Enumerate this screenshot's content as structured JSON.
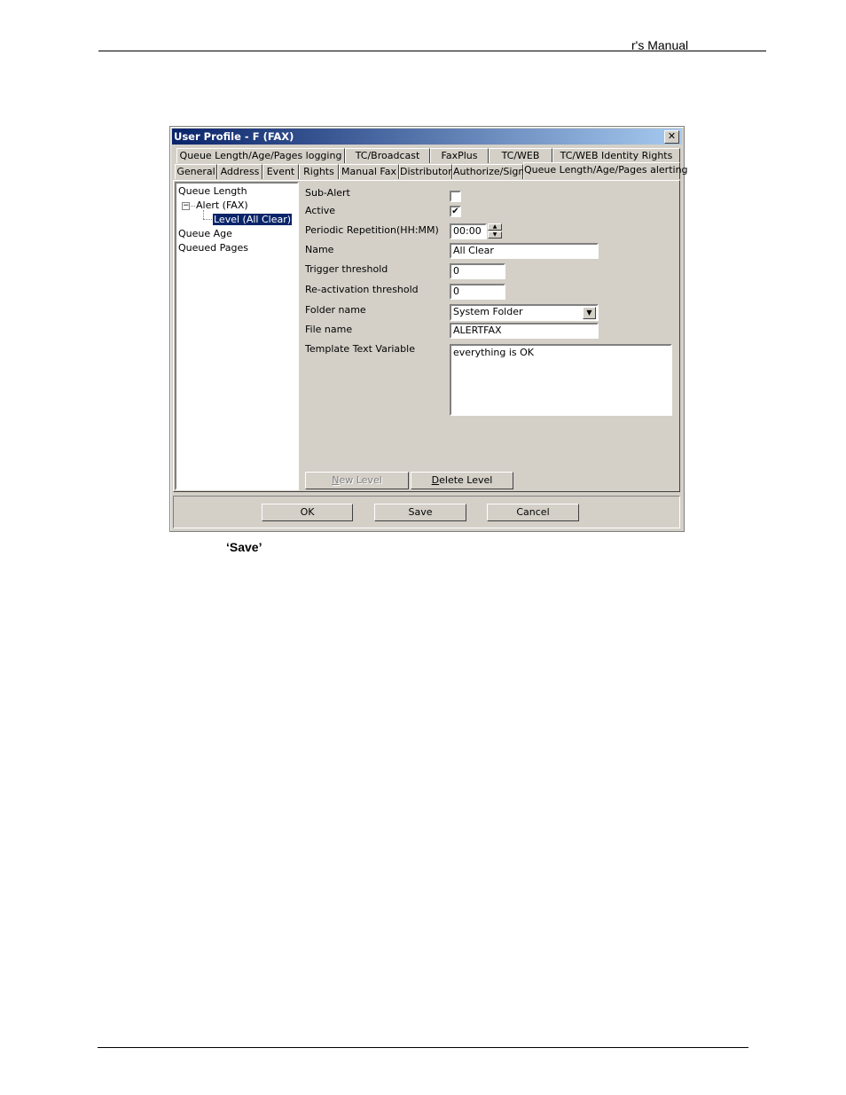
{
  "page": {
    "header_text": "r's Manual",
    "caption": "‘Save’"
  },
  "window": {
    "title": "User Profile - F (FAX)",
    "close_glyph": "✕"
  },
  "tabs_row1": [
    {
      "label": "Queue Length/Age/Pages logging"
    },
    {
      "label": "TC/Broadcast"
    },
    {
      "label": "FaxPlus"
    },
    {
      "label": "TC/WEB"
    },
    {
      "label": "TC/WEB Identity Rights"
    }
  ],
  "tabs_row2": [
    {
      "label": "General"
    },
    {
      "label": "Address"
    },
    {
      "label": "Event"
    },
    {
      "label": "Rights"
    },
    {
      "label": "Manual Fax"
    },
    {
      "label": "Distributor"
    },
    {
      "label": "Authorize/Sign"
    },
    {
      "label": "Queue Length/Age/Pages alerting",
      "active": true
    }
  ],
  "tree": {
    "items": [
      {
        "label": "Queue Length"
      },
      {
        "label": "Alert (FAX)",
        "expander": "−"
      },
      {
        "label": "Level (All Clear)",
        "selected": true
      },
      {
        "label": "Queue Age"
      },
      {
        "label": "Queued Pages"
      }
    ]
  },
  "form": {
    "sub_alert": {
      "label": "Sub-Alert",
      "checked": false,
      "mark": ""
    },
    "active": {
      "label": "Active",
      "checked": true,
      "mark": "✔"
    },
    "periodic": {
      "label": "Periodic Repetition(HH:MM)",
      "value": "00:00",
      "up": "▲",
      "down": "▼"
    },
    "name": {
      "label": "Name",
      "value": "All Clear"
    },
    "trigger": {
      "label": "Trigger threshold",
      "value": "0"
    },
    "reactivation": {
      "label": "Re-activation threshold",
      "value": "0"
    },
    "folder": {
      "label": "Folder name",
      "value": "System Folder",
      "arrow": "▼"
    },
    "file": {
      "label": "File name",
      "value": "ALERTFAX"
    },
    "template": {
      "label": "Template Text Variable",
      "value": "everything is OK"
    }
  },
  "level_buttons": {
    "new_level": {
      "mnemonic": "N",
      "rest": "ew Level",
      "disabled": true
    },
    "delete_level": {
      "mnemonic": "D",
      "rest": "elete Level",
      "disabled": false
    }
  },
  "dialog_buttons": {
    "ok": "OK",
    "save": "Save",
    "cancel": "Cancel"
  }
}
